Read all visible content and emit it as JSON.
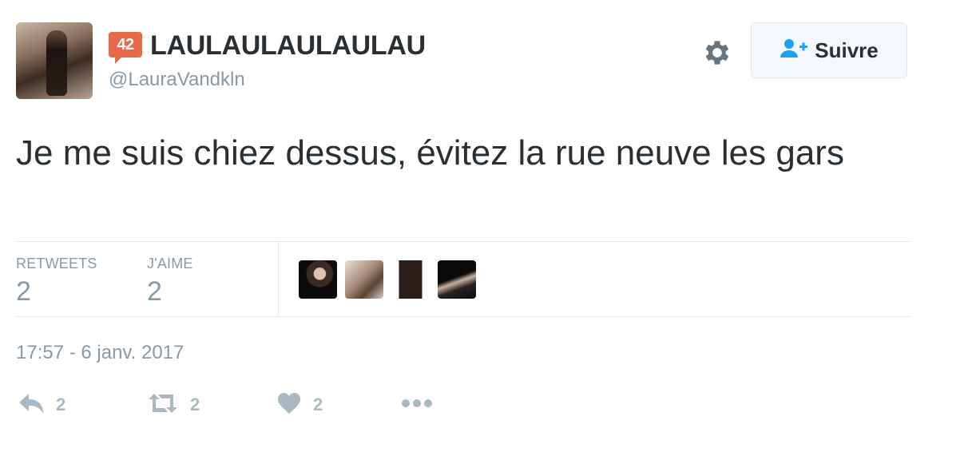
{
  "header": {
    "badge_number": "42",
    "display_name": "LAULAULAULAULAU",
    "handle": "@LauraVandkln",
    "follow_label": "Suivre"
  },
  "tweet": {
    "text": "Je me suis chiez dessus, évitez la rue neuve les gars",
    "timestamp": "17:57 - 6 janv. 2017"
  },
  "stats": {
    "retweets_label": "RETWEETS",
    "retweets_value": "2",
    "likes_label": "J'AIME",
    "likes_value": "2"
  },
  "actions": {
    "reply_count": "2",
    "retweet_count": "2",
    "like_count": "2"
  },
  "icons": {
    "settings": "gear-icon",
    "follow": "add-user-icon",
    "reply": "reply-icon",
    "retweet": "retweet-icon",
    "like": "heart-icon",
    "more": "more-icon"
  },
  "colors": {
    "text": "#292f33",
    "muted": "#8899a6",
    "action_gray": "#aab8c2",
    "follow_blue": "#1da1f2",
    "badge": "#e8684a",
    "divider": "#e1e8ed"
  }
}
